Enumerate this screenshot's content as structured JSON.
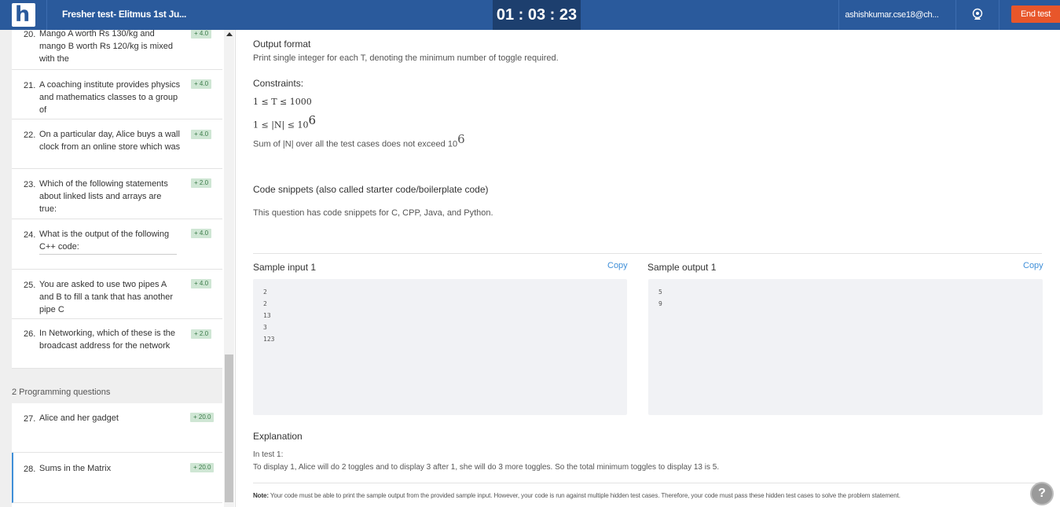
{
  "header": {
    "test_title": "Fresher test- Elitmus 1st Ju...",
    "timer": "01 : 03 : 23",
    "user_email": "ashishkumar.cse18@ch...",
    "end_test_label": "End test",
    "logo_letter": "h"
  },
  "sidebar": {
    "questions": [
      {
        "num": "20.",
        "text": "Mango A worth Rs 130/kg and mango B worth Rs 120/kg is mixed with the",
        "marks": "+ 4.0"
      },
      {
        "num": "21.",
        "text": "A coaching institute provides physics and mathematics classes to a group of",
        "marks": "+ 4.0"
      },
      {
        "num": "22.",
        "text": "On a particular day, Alice buys a wall clock from an online store which was",
        "marks": "+ 4.0"
      },
      {
        "num": "23.",
        "text": "Which of the following statements about linked lists and arrays are true:",
        "marks": "+ 2.0"
      },
      {
        "num": "24.",
        "text": "What is the output of the following C++ code:",
        "marks": "+ 4.0"
      },
      {
        "num": "25.",
        "text": "You are asked to use two pipes A and B to fill a tank that has another pipe C",
        "marks": "+ 4.0"
      },
      {
        "num": "26.",
        "text": "In Networking, which of these is the broadcast address for the network",
        "marks": "+ 2.0"
      }
    ],
    "section_label": "2 Programming questions",
    "programming": [
      {
        "num": "27.",
        "text": "Alice and her gadget",
        "marks": "+ 20.0"
      },
      {
        "num": "28.",
        "text": "Sums in the Matrix",
        "marks": "+ 20.0"
      }
    ]
  },
  "main": {
    "output_format_heading": "Output format",
    "output_format_text": "Print single integer for each T, denoting the minimum number of toggle required.",
    "constraints_heading": "Constraints:",
    "constraint_1": "1 ≤ T ≤ 1000",
    "constraint_2_prefix": "1 ≤ |N| ≤ 10",
    "constraint_2_exp": "6",
    "constraint_3_prefix": "Sum of |N| over all the test cases does not exceed 10",
    "constraint_3_exp": "6",
    "snippets_heading": "Code snippets (also called starter code/boilerplate code)",
    "snippets_text": "This question has code snippets for C, CPP, Java, and Python.",
    "sample_input_heading": "Sample input 1",
    "sample_output_heading": "Sample output 1",
    "copy_label": "Copy",
    "sample_input": [
      "2",
      "2",
      "13",
      "3",
      "123"
    ],
    "sample_output": [
      "5",
      "9"
    ],
    "explanation_heading": "Explanation",
    "explanation_line1": "In test 1:",
    "explanation_line2": "To display 1, Alice will do 2 toggles and to display 3 after 1, she will do 3 more toggles. So the total minimum toggles to display 13 is 5.",
    "note_label": "Note:",
    "note_text": " Your code must be able to print the sample output from the provided sample input. However, your code is run against multiple hidden test cases. Therefore, your code must pass these hidden test cases to solve the problem statement.",
    "help_label": "?"
  },
  "colors": {
    "header_bg": "#2a5a9c",
    "timer_bg": "#1d3f6e",
    "end_test_bg": "#e8562a",
    "marks_badge_bg": "#cfe6d4",
    "link": "#3f8fd8"
  }
}
